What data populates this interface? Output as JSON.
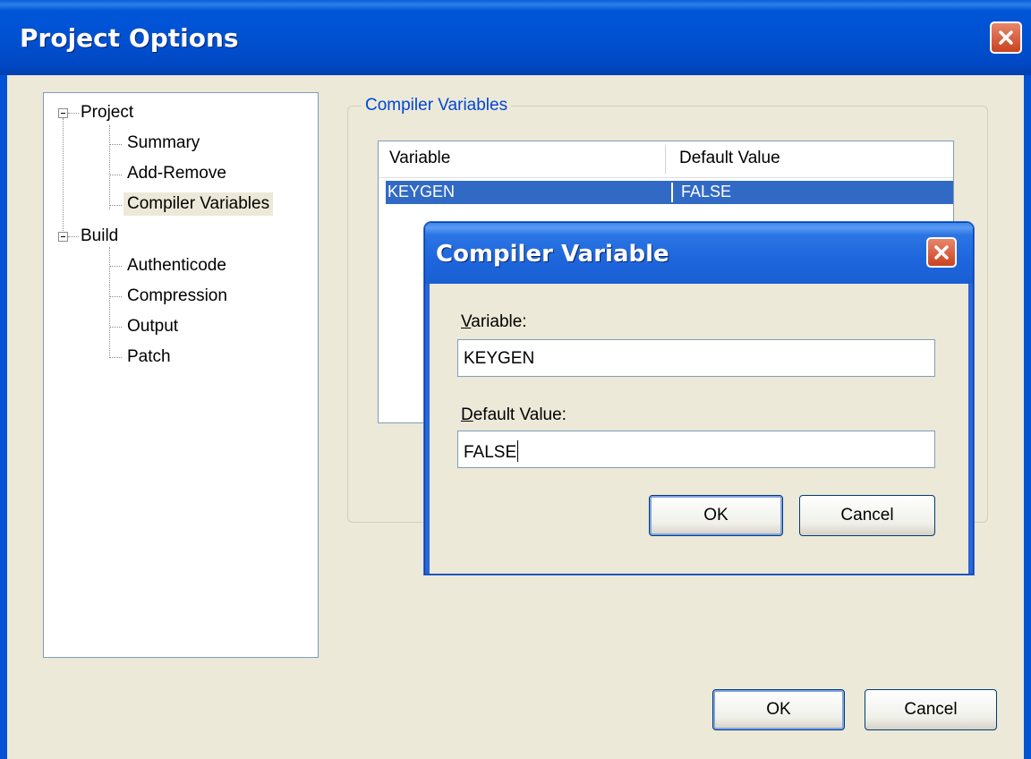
{
  "window": {
    "title": "Project Options"
  },
  "tree": {
    "items": [
      {
        "label": "Project"
      },
      {
        "label": "Summary"
      },
      {
        "label": "Add-Remove"
      },
      {
        "label": "Compiler Variables",
        "selected": true
      },
      {
        "label": "Build"
      },
      {
        "label": "Authenticode"
      },
      {
        "label": "Compression"
      },
      {
        "label": "Output"
      },
      {
        "label": "Patch"
      }
    ]
  },
  "group": {
    "title": "Compiler Variables",
    "columns": [
      "Variable",
      "Default Value"
    ],
    "rows": [
      {
        "variable": "KEYGEN",
        "default_value": "FALSE"
      }
    ]
  },
  "dialog": {
    "title": "Compiler Variable",
    "variable_label_key": "V",
    "variable_label_rest": "ariable:",
    "variable_value": "KEYGEN",
    "default_label_key": "D",
    "default_label_rest": "efault Value:",
    "default_value": "FALSE",
    "ok_label": "OK",
    "cancel_label": "Cancel"
  },
  "footer": {
    "ok_label": "OK",
    "cancel_label": "Cancel"
  },
  "colors": {
    "titlebar": "#0054e3",
    "selection": "#316ac5",
    "group_title": "#0046d5"
  }
}
